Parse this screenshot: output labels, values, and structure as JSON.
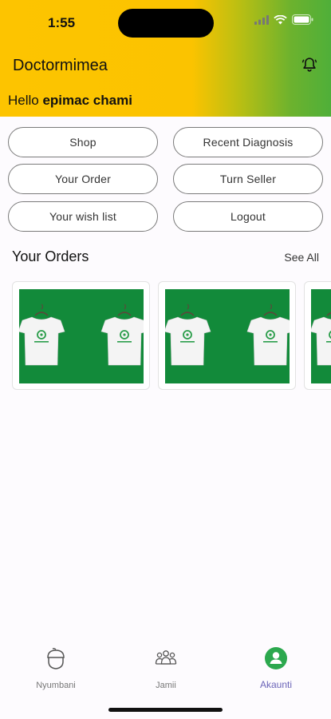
{
  "status_bar": {
    "time": "1:55"
  },
  "header": {
    "app_title": "Doctormimea",
    "greeting_prefix": "Hello ",
    "user_name": "epimac chami"
  },
  "menu": {
    "shop": "Shop",
    "recent_diagnosis": "Recent Diagnosis",
    "your_order": "Your Order",
    "turn_seller": "Turn Seller",
    "wish_list": "Your wish list",
    "logout": "Logout"
  },
  "orders": {
    "title": "Your Orders",
    "see_all": "See All",
    "items": [
      {
        "image": "green-tshirts-product"
      },
      {
        "image": "green-tshirts-product"
      },
      {
        "image": "green-tshirts-product"
      }
    ]
  },
  "tabbar": {
    "home": "Nyumbani",
    "community": "Jamii",
    "account": "Akaunti",
    "active": "account"
  },
  "colors": {
    "header_gradient_start": "#fdc400",
    "header_gradient_end": "#4faf39",
    "active_tab": "#6b64b8",
    "account_icon": "#2ca84e",
    "product_bg": "#128a3a"
  }
}
